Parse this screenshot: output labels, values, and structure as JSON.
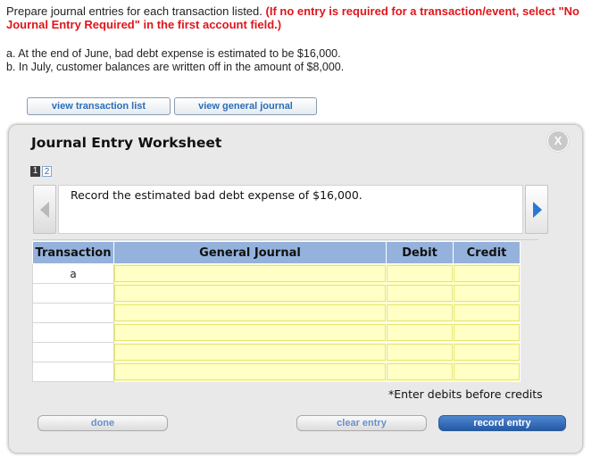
{
  "instructions": {
    "lead": "Prepare journal entries for each transaction listed.",
    "warning": "(If no entry is required for a transaction/event, select \"No Journal Entry Required\" in the first account field.)"
  },
  "transactions": [
    "a.  At the end of June, bad debt expense is estimated to be $16,000.",
    "b.  In July, customer balances are written off in the amount of $8,000."
  ],
  "buttons": {
    "view_transaction_list": "view transaction list",
    "view_general_journal": "view general journal",
    "done": "done",
    "clear_entry": "clear entry",
    "record_entry": "record entry"
  },
  "worksheet": {
    "title": "Journal Entry Worksheet",
    "close_label": "X",
    "pages": [
      "1",
      "2"
    ],
    "current_page": "1",
    "description": "Record the estimated bad debt expense of $16,000.",
    "columns": [
      "Transaction",
      "General Journal",
      "Debit",
      "Credit"
    ],
    "rows": [
      {
        "transaction": "a",
        "account": "",
        "debit": "",
        "credit": ""
      },
      {
        "transaction": "",
        "account": "",
        "debit": "",
        "credit": ""
      },
      {
        "transaction": "",
        "account": "",
        "debit": "",
        "credit": ""
      },
      {
        "transaction": "",
        "account": "",
        "debit": "",
        "credit": ""
      },
      {
        "transaction": "",
        "account": "",
        "debit": "",
        "credit": ""
      },
      {
        "transaction": "",
        "account": "",
        "debit": "",
        "credit": ""
      }
    ],
    "note": "*Enter debits before credits"
  },
  "icons": {
    "prev": "chevron-left-icon",
    "next": "chevron-right-icon",
    "close": "close-icon"
  },
  "colors": {
    "warning_red": "#e0151b",
    "header_blue": "#95b2dd",
    "input_yellow": "#ffffbf",
    "record_button": "#245aa6",
    "next_arrow": "#2a78d6"
  }
}
